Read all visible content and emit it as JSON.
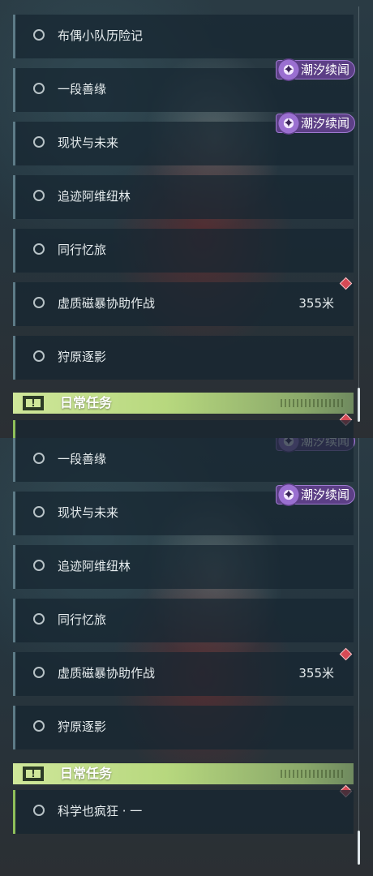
{
  "badge_text": "潮汐续闻",
  "top_panel": {
    "quests": [
      {
        "name": "布偶小队历险记",
        "distance": ""
      },
      {
        "name": "一段善缘",
        "distance": ""
      },
      {
        "name": "现状与未来",
        "distance": ""
      },
      {
        "name": "追迹阿维纽林",
        "distance": ""
      },
      {
        "name": "同行忆旅",
        "distance": ""
      },
      {
        "name": "虚质磁暴协助作战",
        "distance": "355米"
      },
      {
        "name": "狩原逐影",
        "distance": ""
      }
    ],
    "section_title": "日常任务"
  },
  "bottom_panel": {
    "quests": [
      {
        "name": "一段善缘",
        "distance": ""
      },
      {
        "name": "现状与未来",
        "distance": ""
      },
      {
        "name": "追迹阿维纽林",
        "distance": ""
      },
      {
        "name": "同行忆旅",
        "distance": ""
      },
      {
        "name": "虚质磁暴协助作战",
        "distance": "355米"
      },
      {
        "name": "狩原逐影",
        "distance": ""
      }
    ],
    "section_title": "日常任务",
    "daily_quests": [
      {
        "name": "科学也疯狂 · 一"
      }
    ]
  },
  "colors": {
    "row_bg": "#162630",
    "accent_green": "#b7d87e",
    "badge_purple": "#5c3f86",
    "marker_red": "#d64a55"
  },
  "icons": {
    "radio": "radio-circle-icon",
    "badge": "tidal-emblem-icon",
    "marker": "quest-marker-diamond-icon",
    "section": "exclamation-icon"
  }
}
